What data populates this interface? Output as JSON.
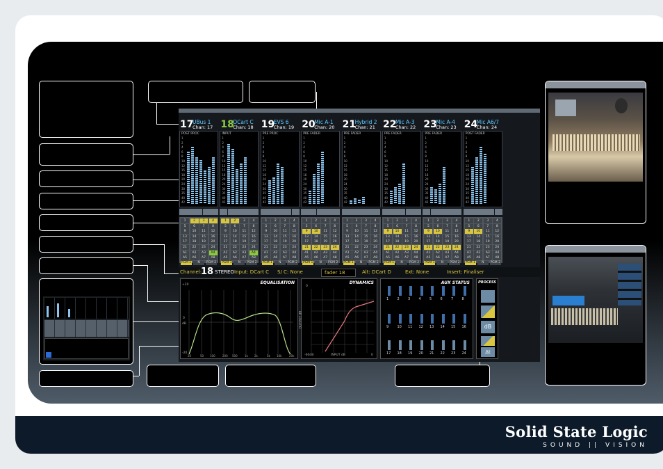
{
  "brand": {
    "name": "Solid State Logic",
    "tagline": "SOUND || VISION"
  },
  "channels": [
    {
      "num": "17",
      "name": "UBus 1",
      "chan": "Chan: 17",
      "meter_label": "POST PROC",
      "num_color": "#ffffff"
    },
    {
      "num": "18",
      "name": "DCart C",
      "chan": "Chan: 18",
      "meter_label": "INPUT",
      "num_color": "#8cc93f"
    },
    {
      "num": "19",
      "name": "EVS 6",
      "chan": "Chan: 19",
      "meter_label": "PRE PROC",
      "num_color": "#ffffff"
    },
    {
      "num": "20",
      "name": "Mic A-1",
      "chan": "Chan: 20",
      "meter_label": "PRE FADER",
      "num_color": "#ffffff"
    },
    {
      "num": "21",
      "name": "Hybrid 2",
      "chan": "Chan: 21",
      "meter_label": "PRE FADER",
      "num_color": "#ffffff"
    },
    {
      "num": "22",
      "name": "Mic A-3",
      "chan": "Chan: 22",
      "meter_label": "PRE FADER",
      "num_color": "#ffffff"
    },
    {
      "num": "23",
      "name": "Mic A-4",
      "chan": "Chan: 23",
      "meter_label": "PRE FADER",
      "num_color": "#ffffff"
    },
    {
      "num": "24",
      "name": "Mic A6/7",
      "chan": "Chan: 24",
      "meter_label": "POST FADER",
      "num_color": "#ffffff"
    }
  ],
  "meter_scale": [
    "1",
    "2",
    "4",
    "6",
    "8",
    "10",
    "12",
    "15",
    "18",
    "20",
    "24",
    "30",
    "35",
    "40",
    "42"
  ],
  "routing_grid": {
    "rows": [
      [
        "1",
        "2",
        "3",
        "4"
      ],
      [
        "5",
        "6",
        "7",
        "8"
      ],
      [
        "9",
        "10",
        "11",
        "12"
      ],
      [
        "13",
        "14",
        "15",
        "16"
      ],
      [
        "17",
        "18",
        "19",
        "20"
      ],
      [
        "21",
        "22",
        "23",
        "24"
      ],
      [
        "A1",
        "A2",
        "A3",
        "A4"
      ],
      [
        "A5",
        "A6",
        "A7",
        "A8"
      ]
    ],
    "buttons": [
      "PGM 1",
      "N",
      "PGM 2"
    ]
  },
  "status_bar": {
    "channel_label": "Channel:",
    "channel_value": "18",
    "mode": "STEREO",
    "input": "Input: DCart C",
    "sc": "S/ C: None",
    "fader": "fader 18",
    "alt": "Alt: DCart D",
    "ext": "Ext: None",
    "insert": "Insert: Finaliser"
  },
  "panels": {
    "eq": {
      "title": "EQUALISATION",
      "y_ticks": [
        "+20",
        "0",
        "dB",
        "-20"
      ],
      "x_ticks": [
        "20",
        "50",
        "100",
        "200",
        "500",
        "1k",
        "2k",
        "5k",
        "10k",
        "20k"
      ]
    },
    "dynamics": {
      "title": "DYNAMICS",
      "ylabel": "OUTPUT dB",
      "xlabel": "INPUT dB",
      "x_left": "-60dB",
      "x_right": "0",
      "y_top": "0"
    },
    "aux": {
      "title": "AUX STATUS",
      "row1": [
        "1",
        "2",
        "3",
        "4",
        "5",
        "6",
        "7",
        "8"
      ],
      "row2": [
        "9",
        "10",
        "11",
        "12",
        "13",
        "14",
        "15",
        "16"
      ],
      "row3": [
        "17",
        "18",
        "19",
        "20",
        "21",
        "22",
        "23",
        "24"
      ]
    },
    "process": {
      "title": "PROCESS",
      "labels": [
        "dB",
        "Δt"
      ]
    }
  },
  "colors": {
    "accent": "#5fc8ff",
    "yellow": "#d9c640",
    "green": "#8cc93f",
    "meter": "#8cc4ee"
  }
}
